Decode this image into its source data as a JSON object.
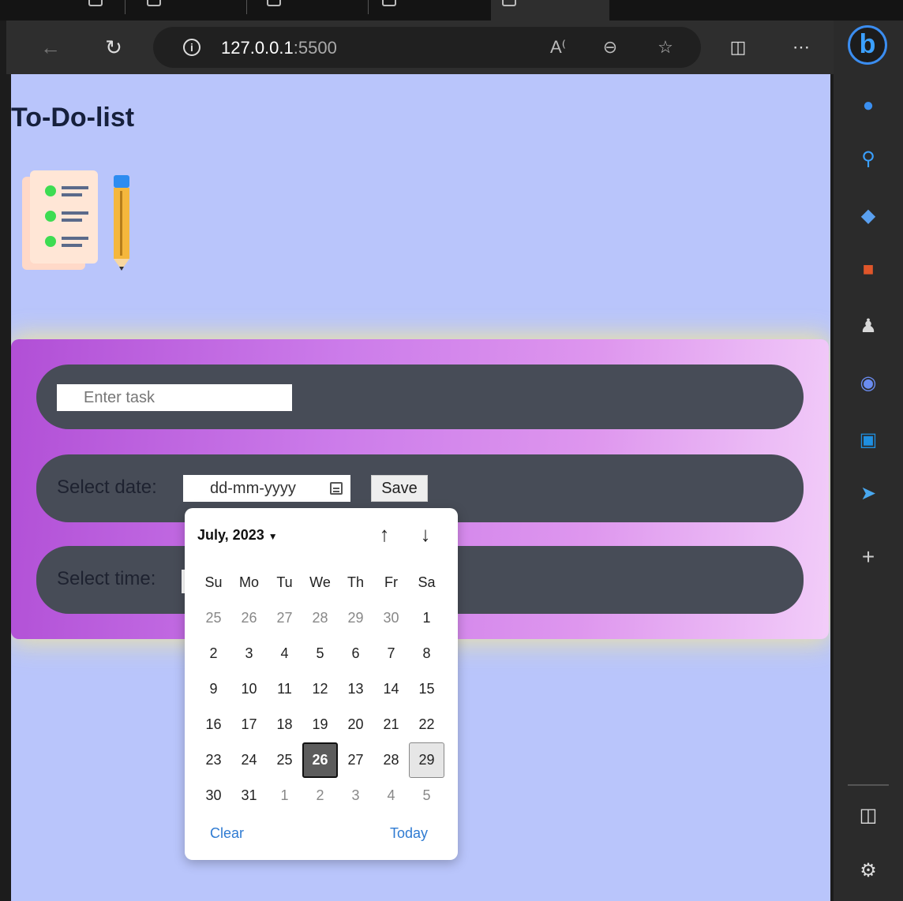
{
  "browser": {
    "url_host": "127.0.0.1",
    "url_port": ":5500"
  },
  "page": {
    "title": "To-Do-list"
  },
  "form": {
    "task_placeholder": "Enter task",
    "date_label": "Select date:",
    "date_placeholder": "dd-mm-yyyy",
    "save_label": "Save",
    "time_label": "Select time:"
  },
  "datepicker": {
    "month_label": "July, 2023",
    "weekdays": [
      "Su",
      "Mo",
      "Tu",
      "We",
      "Th",
      "Fr",
      "Sa"
    ],
    "weeks": [
      [
        "25",
        "26",
        "27",
        "28",
        "29",
        "30",
        "1"
      ],
      [
        "2",
        "3",
        "4",
        "5",
        "6",
        "7",
        "8"
      ],
      [
        "9",
        "10",
        "11",
        "12",
        "13",
        "14",
        "15"
      ],
      [
        "16",
        "17",
        "18",
        "19",
        "20",
        "21",
        "22"
      ],
      [
        "23",
        "24",
        "25",
        "26",
        "27",
        "28",
        "29"
      ],
      [
        "30",
        "31",
        "1",
        "2",
        "3",
        "4",
        "5"
      ]
    ],
    "today_day": "26",
    "selected_day": "29",
    "clear_label": "Clear",
    "today_label": "Today"
  },
  "colors": {
    "page_background": "#b9c5fb",
    "row_background": "#474c57",
    "link_blue": "#2f7bd2"
  }
}
